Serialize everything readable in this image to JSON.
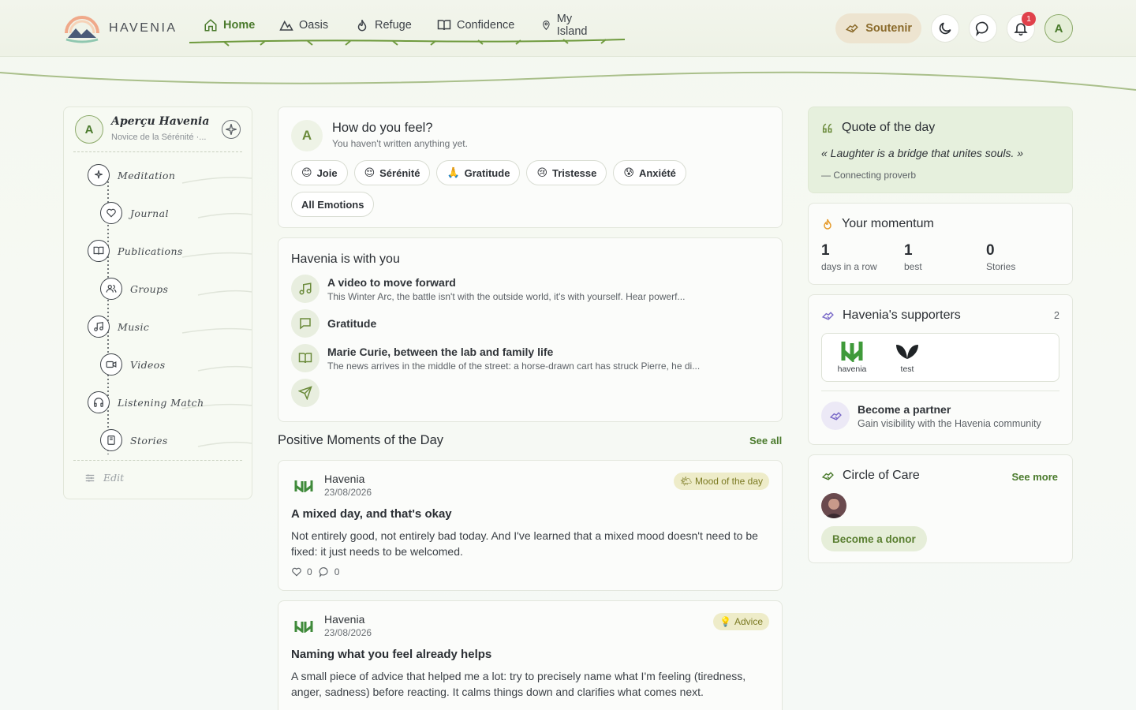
{
  "brand": {
    "name": "HAVENIA"
  },
  "nav": {
    "items": [
      {
        "label": "Home",
        "icon": "home-icon",
        "active": true
      },
      {
        "label": "Oasis",
        "icon": "mountain-icon"
      },
      {
        "label": "Refuge",
        "icon": "flame-icon"
      },
      {
        "label": "Confidence",
        "icon": "book-icon"
      },
      {
        "label": "My Island",
        "icon": "map-pin-icon"
      }
    ]
  },
  "topbar": {
    "support_label": "Soutenir",
    "notification_count": "1",
    "user_initial": "A"
  },
  "sidebar": {
    "title": "Aperçu Havenia",
    "subtitle": "Novice de la Sérénité ·...",
    "avatar_initial": "A",
    "items": [
      {
        "label": "Meditation",
        "icon": "sparkle-icon"
      },
      {
        "label": "Journal",
        "icon": "heart-icon"
      },
      {
        "label": "Publications",
        "icon": "open-book-icon"
      },
      {
        "label": "Groups",
        "icon": "users-icon"
      },
      {
        "label": "Music",
        "icon": "music-icon"
      },
      {
        "label": "Videos",
        "icon": "video-icon"
      },
      {
        "label": "Listening Match",
        "icon": "headphones-icon"
      },
      {
        "label": "Stories",
        "icon": "notebook-icon"
      }
    ],
    "edit_label": "Edit"
  },
  "mood": {
    "avatar_initial": "A",
    "question": "How do you feel?",
    "subtitle": "You haven't written anything yet.",
    "chips": [
      {
        "emoji": "😊",
        "label": "Joie"
      },
      {
        "emoji": "😌",
        "label": "Sérénité"
      },
      {
        "emoji": "🙏",
        "label": "Gratitude"
      },
      {
        "emoji": "😢",
        "label": "Tristesse"
      },
      {
        "emoji": "😰",
        "label": "Anxiété"
      }
    ],
    "all_label": "All Emotions"
  },
  "with_you": {
    "title": "Havenia is with you",
    "items": [
      {
        "icon": "music-note-icon",
        "title": "A video to move forward",
        "desc": "This Winter Arc, the battle isn't with the outside world, it's with yourself. Hear powerf..."
      },
      {
        "icon": "chat-bubble-icon",
        "title": "Gratitude",
        "desc": ""
      },
      {
        "icon": "book-icon",
        "title": "Marie Curie, between the lab and family life",
        "desc": "The news arrives in the middle of the street: a horse-drawn cart has struck Pierre, he di..."
      },
      {
        "icon": "send-icon",
        "title": "",
        "desc": ""
      }
    ]
  },
  "moments": {
    "title": "Positive Moments of the Day",
    "see_all": "See all",
    "posts": [
      {
        "author": "Havenia",
        "date": "23/08/2026",
        "badge_emoji": "🌤",
        "badge": "Mood of the day",
        "title": "A mixed day, and that's okay",
        "body": "Not entirely good, not entirely bad today. And I've learned that a mixed mood doesn't need to be fixed: it just needs to be welcomed.",
        "likes": "0",
        "comments": "0"
      },
      {
        "author": "Havenia",
        "date": "23/08/2026",
        "badge_emoji": "💡",
        "badge": "Advice",
        "title": "Naming what you feel already helps",
        "body": "A small piece of advice that helped me a lot: try to precisely name what I'm feeling (tiredness, anger, sadness) before reacting. It calms things down and clarifies what comes next."
      }
    ]
  },
  "quote": {
    "title": "Quote of the day",
    "text": "« Laughter is a bridge that unites souls. »",
    "source": "— Connecting proverb"
  },
  "momentum": {
    "title": "Your momentum",
    "stats": [
      {
        "value": "1",
        "label": "days in a row"
      },
      {
        "value": "1",
        "label": "best"
      },
      {
        "value": "0",
        "label": "Stories"
      }
    ]
  },
  "supporters": {
    "title": "Havenia's supporters",
    "count": "2",
    "items": [
      {
        "name": "havenia",
        "logo": "havenia-logo"
      },
      {
        "name": "test",
        "logo": "leaf-logo"
      }
    ],
    "partner_title": "Become a partner",
    "partner_desc": "Gain visibility with the Havenia community"
  },
  "circle": {
    "title": "Circle of Care",
    "see_more": "See more",
    "donor_label": "Become a donor"
  },
  "colors": {
    "accent": "#4a7a2c",
    "support_bg": "#ede4d0",
    "badge_bg": "#eeecc9",
    "notification": "#e0414b"
  }
}
